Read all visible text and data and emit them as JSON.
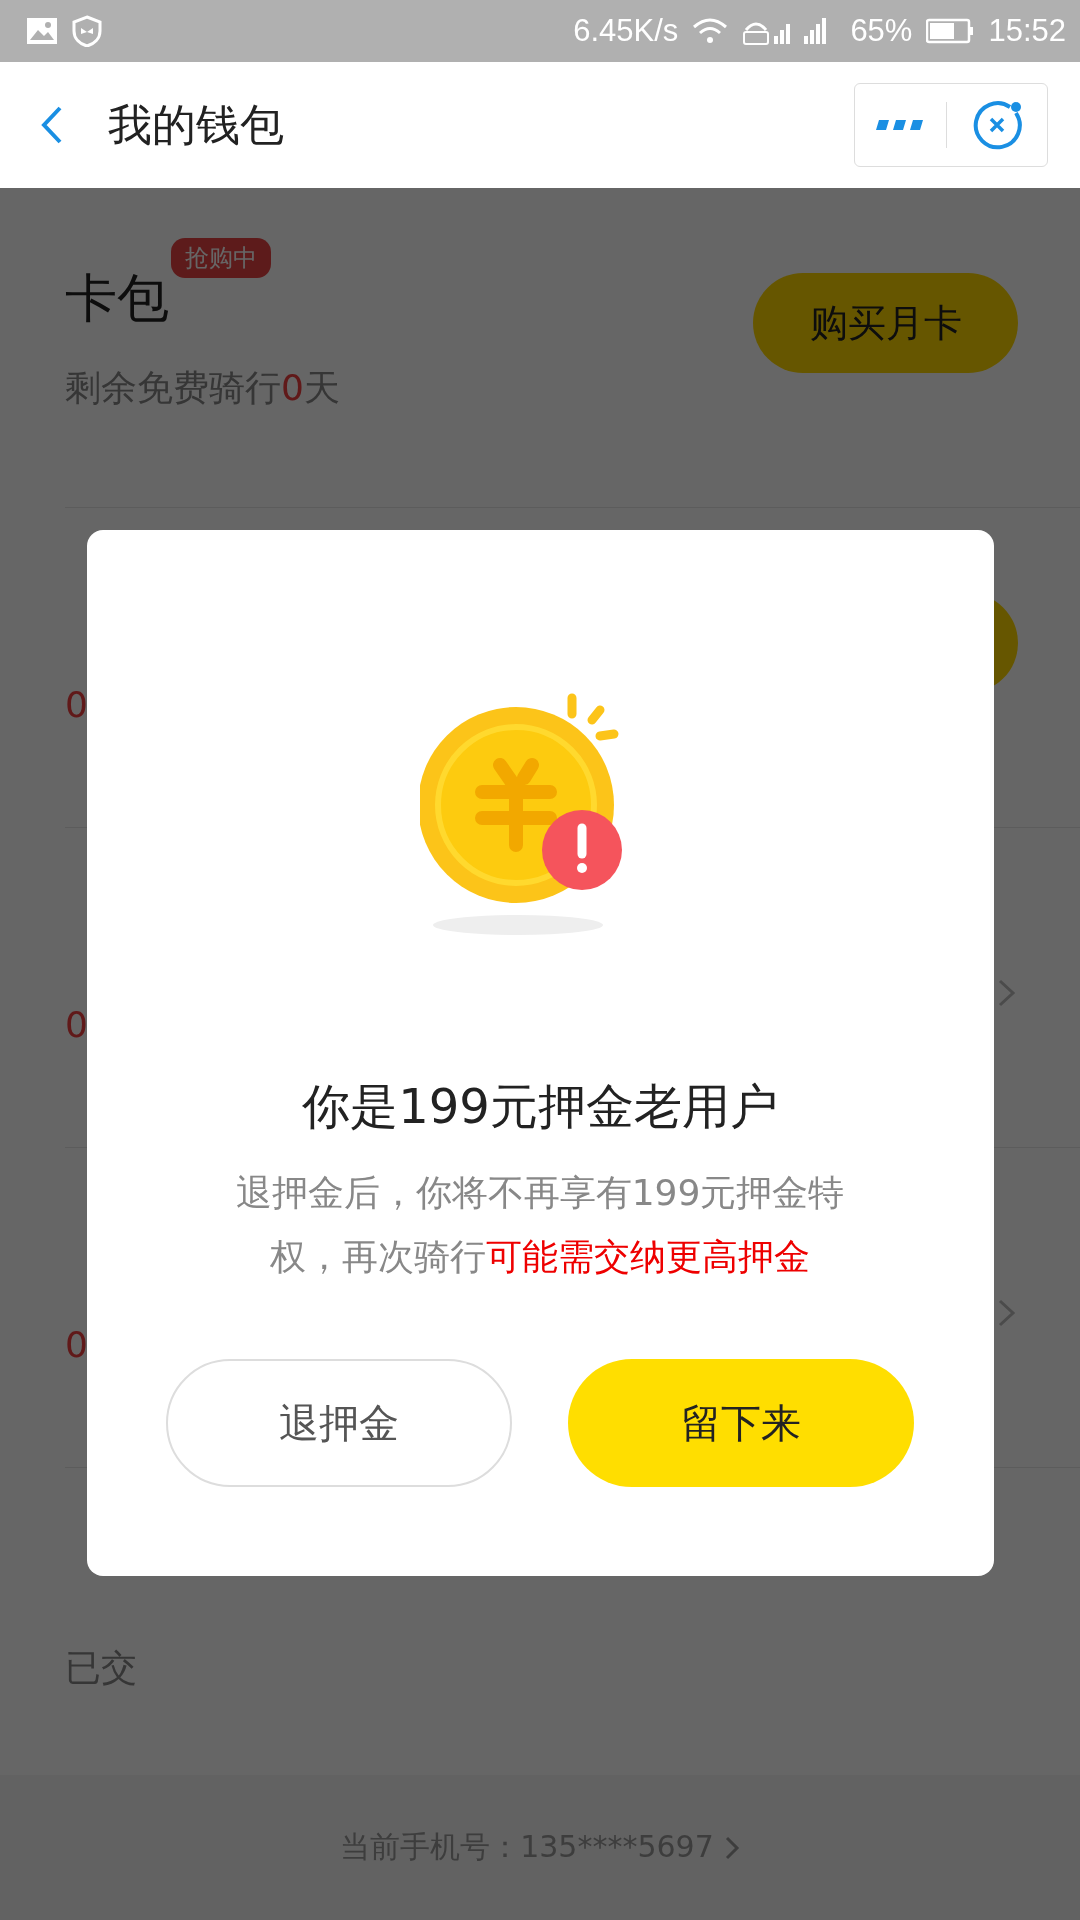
{
  "status_bar": {
    "speed": "6.45K/s",
    "battery": "65%",
    "time": "15:52"
  },
  "header": {
    "title": "我的钱包"
  },
  "rows": [
    {
      "kind": "card",
      "title": "卡包",
      "badge": "抢购中",
      "subtitle": "剩余免费骑行",
      "highlight": "0",
      "suffix": "天",
      "action": {
        "kind": "button",
        "label": "购买月卡"
      }
    },
    {
      "kind": "amount",
      "highlight": "0",
      "action": {
        "kind": "button"
      }
    },
    {
      "kind": "amount",
      "highlight": "0",
      "action": {
        "kind": "chevron"
      }
    },
    {
      "kind": "amount",
      "highlight": "0",
      "action": {
        "kind": "chevron"
      }
    },
    {
      "kind": "plain",
      "subtitle": "已交"
    }
  ],
  "footer": {
    "text": "当前手机号：135****5697"
  },
  "dialog": {
    "title": "你是199元押金老用户",
    "message": "退押金后，你将不再享有199元押金特权，再次骑行",
    "warning": "可能需交纳更高押金",
    "buttons": [
      {
        "label": "退押金",
        "primary": false
      },
      {
        "label": "留下来",
        "primary": true
      }
    ]
  }
}
